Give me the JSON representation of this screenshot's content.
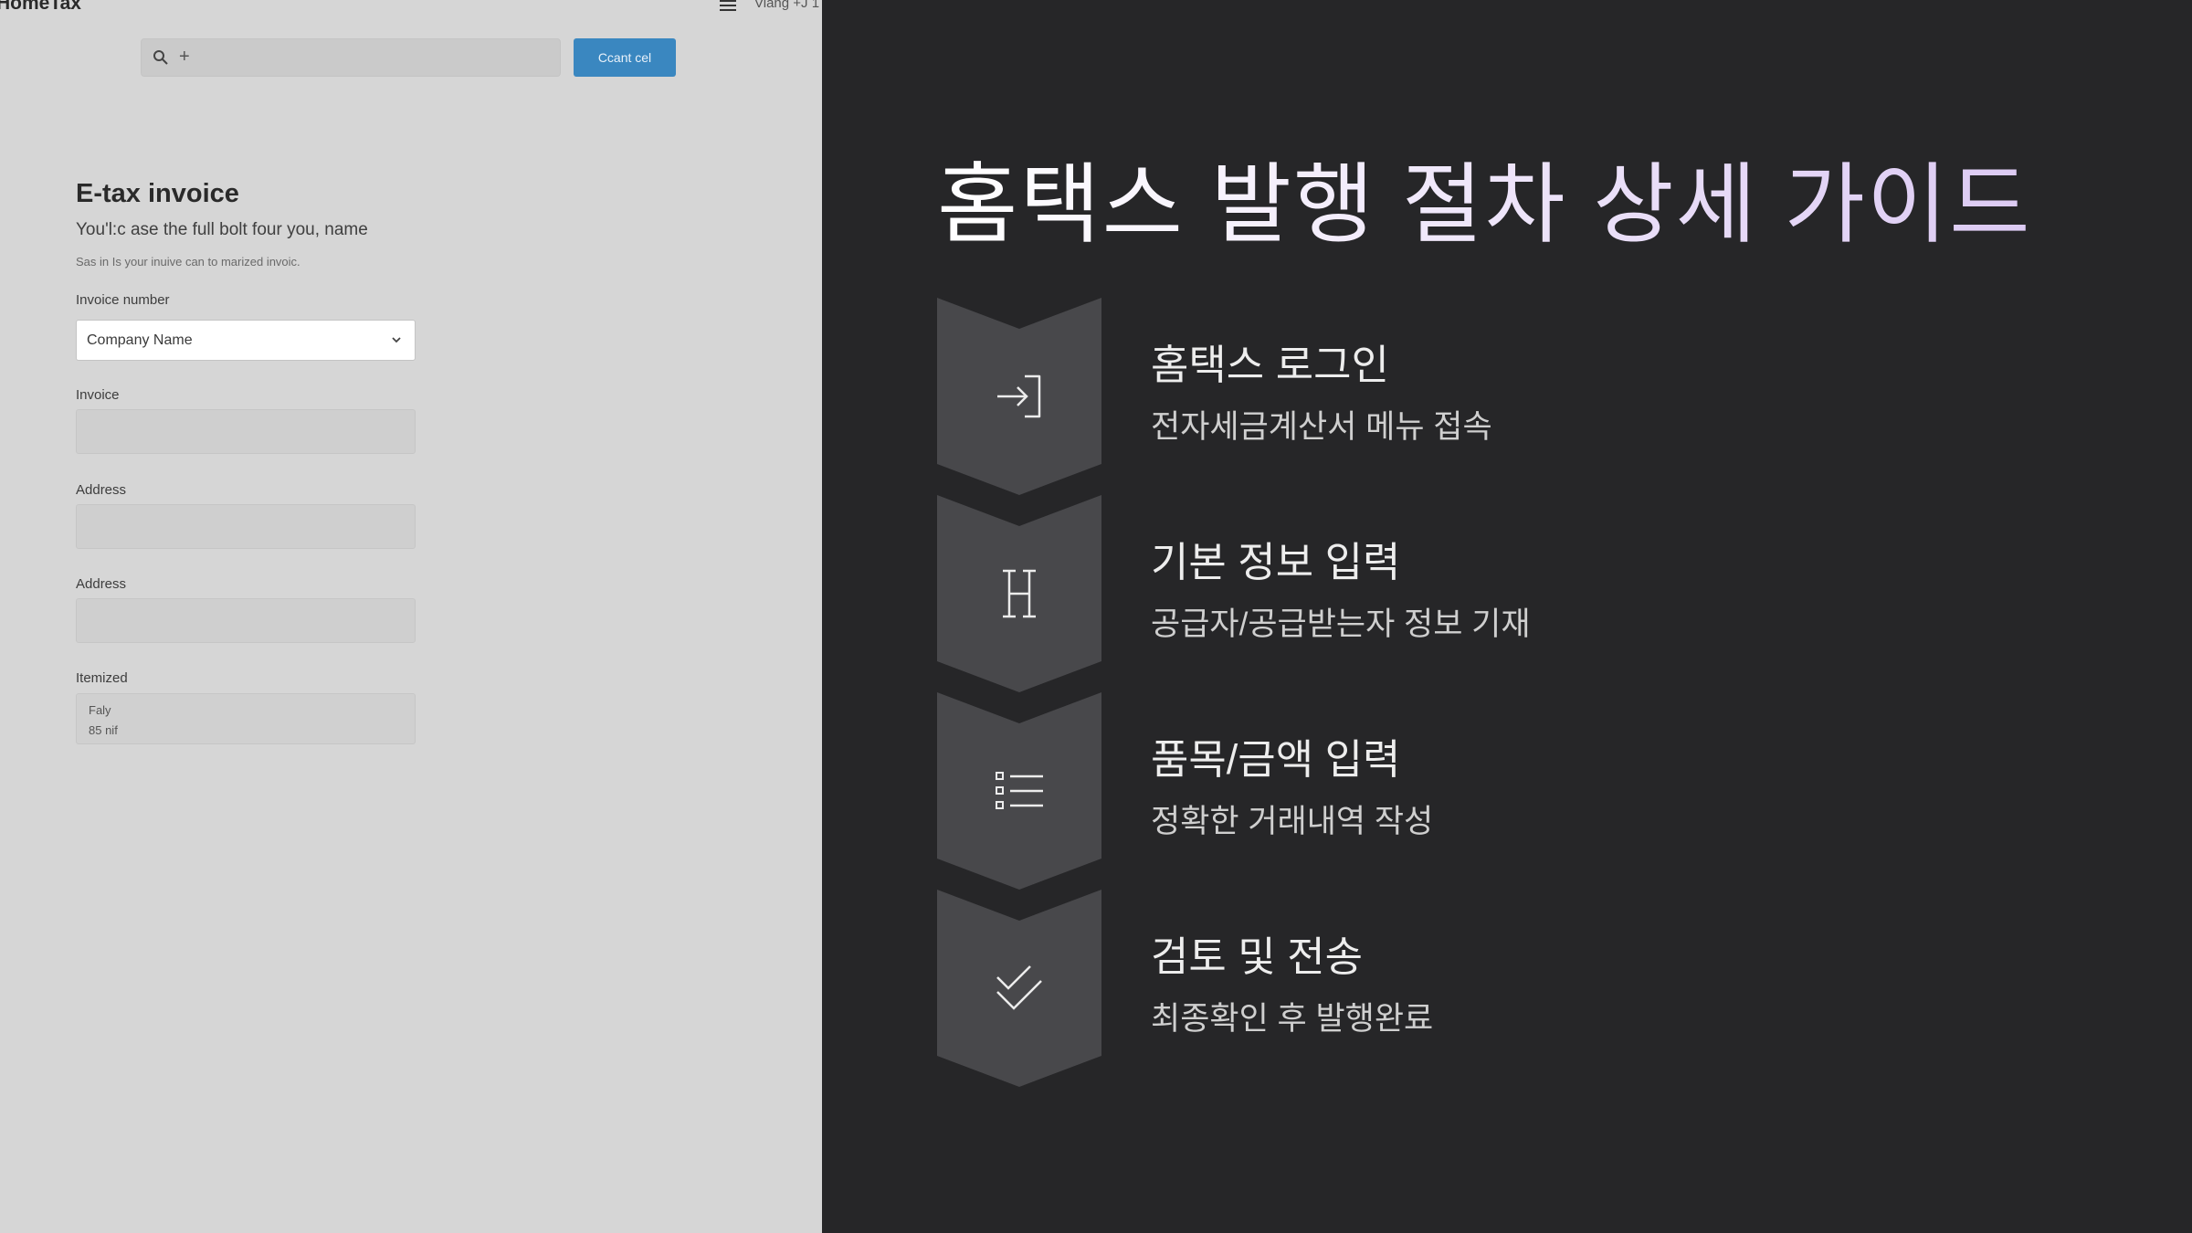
{
  "app": {
    "brand": "HomeTax",
    "top_right": "Viang +J 1"
  },
  "search": {
    "plus": "+",
    "button_label": "Ccant cel"
  },
  "form": {
    "title": "E-tax invoice",
    "subtitle": "You'l:c ase the full bolt four you, name",
    "note": "Sas in Is your inuive can to marized invoic.",
    "invoice_number_label": "Invoice number",
    "company_select_value": "Company Name",
    "invoice_label": "Invoice",
    "address_label_1": "Address",
    "address_label_2": "Address",
    "itemized_label": "Itemized",
    "itemized_line_1": "Faly",
    "itemized_line_2": "85 nif"
  },
  "guide": {
    "title": "홈택스 발행 절차 상세 가이드",
    "steps": [
      {
        "icon": "login-arrow-icon",
        "title": "홈택스 로그인",
        "desc": "전자세금계산서 메뉴 접속"
      },
      {
        "icon": "letter-h-icon",
        "title": "기본 정보 입력",
        "desc": "공급자/공급받는자 정보 기재"
      },
      {
        "icon": "list-icon",
        "title": "품목/금액 입력",
        "desc": "정확한 거래내역 작성"
      },
      {
        "icon": "checkmark-icon",
        "title": "검토 및 전송",
        "desc": "최종확인 후 발행완료"
      }
    ]
  },
  "colors": {
    "panel_background": "#262628",
    "chevron_fill": "#48484b",
    "form_background": "#d6d6d6",
    "accent_button": "#3a87c0",
    "title_gradient_end": "#dccaf3"
  }
}
